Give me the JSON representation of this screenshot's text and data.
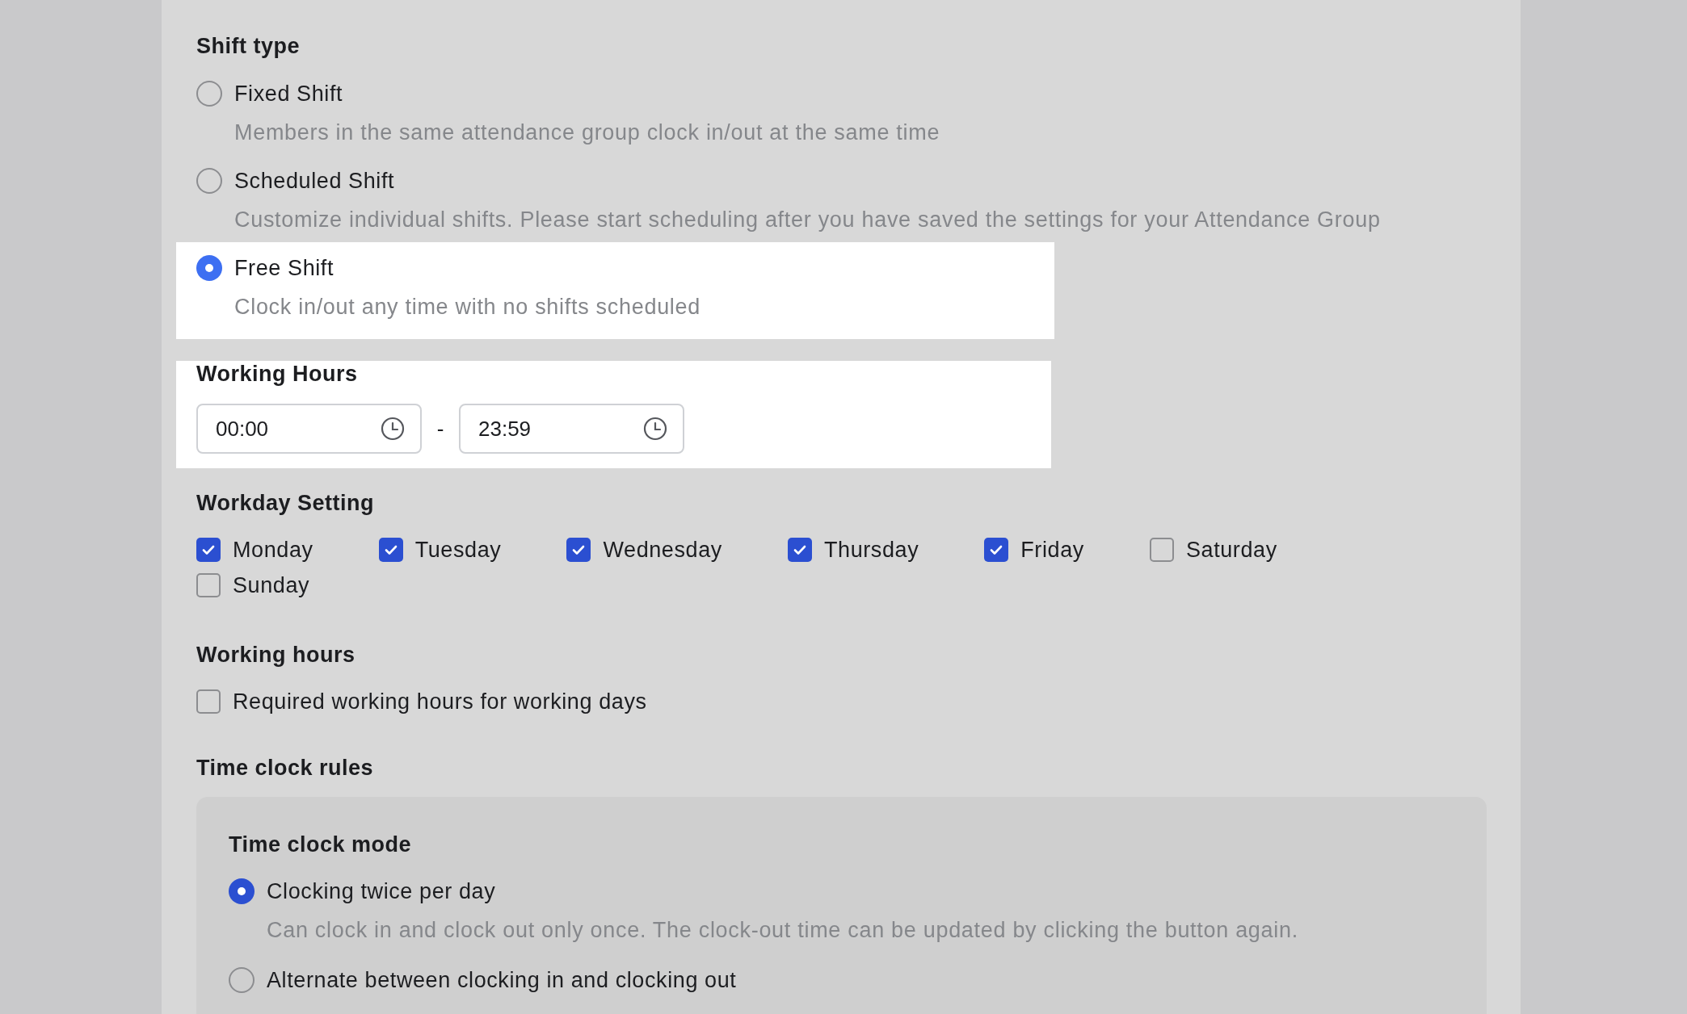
{
  "shift_type": {
    "title": "Shift type",
    "options": [
      {
        "label": "Fixed Shift",
        "description": "Members in the same attendance group clock in/out at the same time",
        "selected": false,
        "highlighted": false
      },
      {
        "label": "Scheduled Shift",
        "description": "Customize individual shifts. Please start scheduling after you have saved the settings for your Attendance Group",
        "selected": false,
        "highlighted": false
      },
      {
        "label": "Free Shift",
        "description": "Clock in/out any time with no shifts scheduled",
        "selected": true,
        "highlighted": true
      }
    ]
  },
  "working_hours_range": {
    "title": "Working Hours",
    "highlighted": true,
    "start": "00:00",
    "separator": "-",
    "end": "23:59"
  },
  "workday_setting": {
    "title": "Workday Setting",
    "days": [
      {
        "label": "Monday",
        "checked": true
      },
      {
        "label": "Tuesday",
        "checked": true
      },
      {
        "label": "Wednesday",
        "checked": true
      },
      {
        "label": "Thursday",
        "checked": true
      },
      {
        "label": "Friday",
        "checked": true
      },
      {
        "label": "Saturday",
        "checked": false
      },
      {
        "label": "Sunday",
        "checked": false
      }
    ]
  },
  "working_hours": {
    "title": "Working hours",
    "options": [
      {
        "label": "Required working hours for working days",
        "checked": false
      }
    ]
  },
  "time_clock_rules": {
    "title": "Time clock rules",
    "mode": {
      "title": "Time clock mode",
      "options": [
        {
          "label": "Clocking twice per day",
          "description": "Can clock in and clock out only once. The clock-out time can be updated by clicking the button again.",
          "selected": true
        },
        {
          "label": "Alternate between clocking in and clocking out",
          "selected": false
        }
      ]
    }
  }
}
